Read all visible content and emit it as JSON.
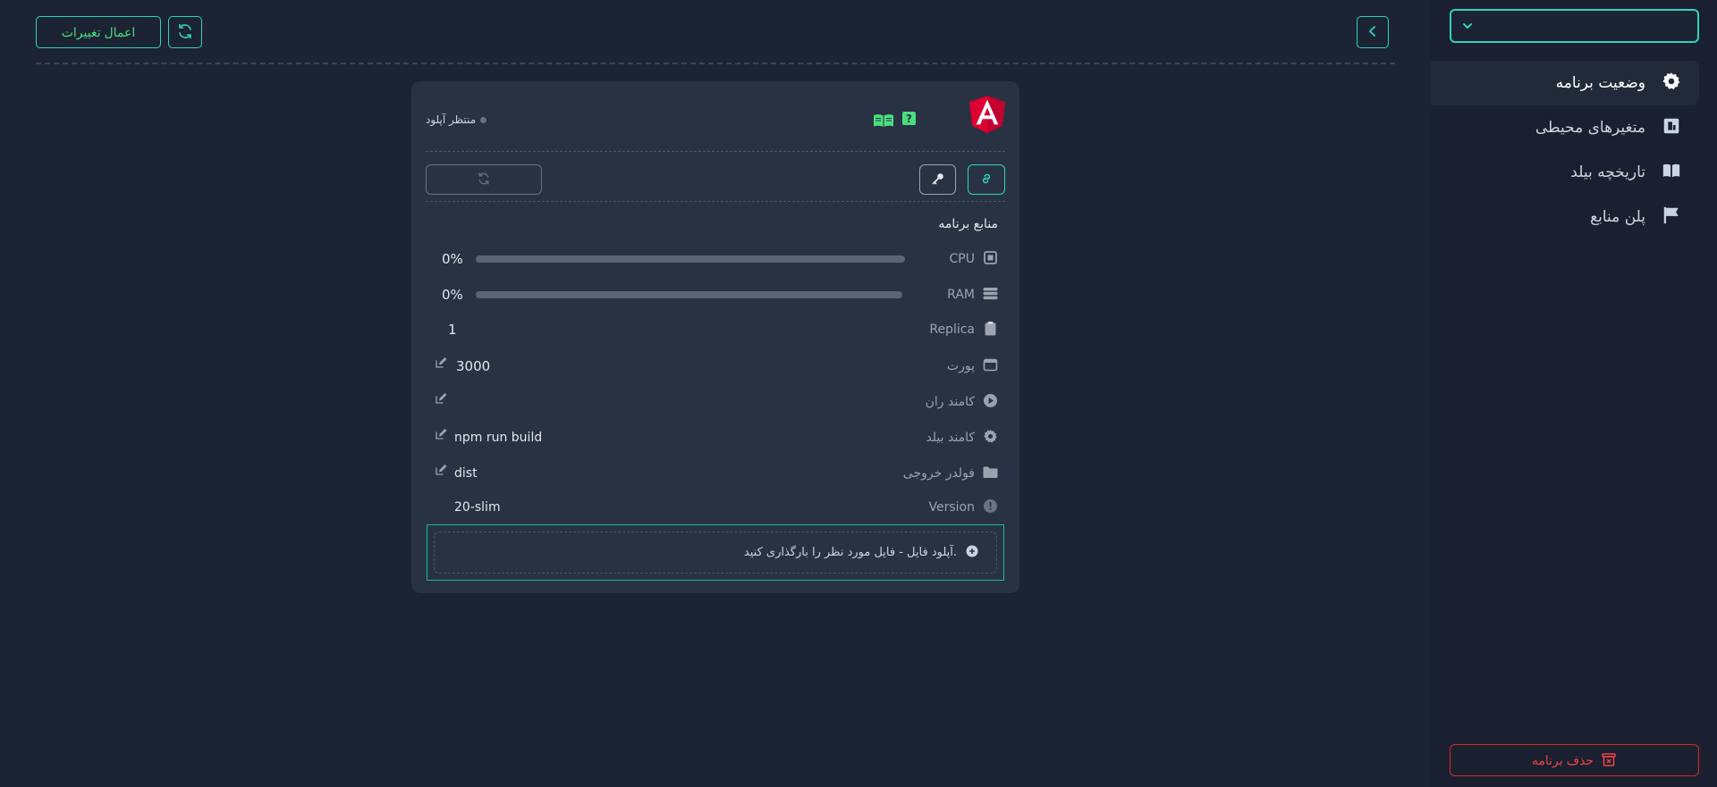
{
  "sidebar": {
    "select": {
      "value": "",
      "icon": "chevron-down-icon"
    },
    "items": [
      {
        "label": "وضعیت برنامه",
        "icon": "gear-icon",
        "active": true
      },
      {
        "label": "متغیرهای محیطی",
        "icon": "env-icon",
        "active": false
      },
      {
        "label": "تاریخچه بیلد",
        "icon": "book-icon",
        "active": false
      },
      {
        "label": "پلن منابع",
        "icon": "flag-icon",
        "active": false
      }
    ],
    "delete_label": "حذف برنامه"
  },
  "topbar": {
    "apply_label": "اعمال تغییرات",
    "refresh_icon": "refresh-icon",
    "back_icon": "chevron-left-icon"
  },
  "card": {
    "status": "منتظر آپلود",
    "logo": "angular-logo",
    "resources_title": "منابع برنامه",
    "rows": {
      "cpu": {
        "label": "CPU",
        "value": "0%",
        "percent": 0
      },
      "ram": {
        "label": "RAM",
        "value": "0%",
        "percent": 0
      },
      "replica": {
        "label": "Replica",
        "value": "1"
      },
      "port": {
        "label": "پورت",
        "value": "3000"
      },
      "run_command": {
        "label": "کامند ران",
        "value": ""
      },
      "build_command": {
        "label": "کامند بیلد",
        "value": "npm run build"
      },
      "output_folder": {
        "label": "فولدر خروجی",
        "value": "dist"
      },
      "version": {
        "label": "Version",
        "value": "20-slim"
      }
    },
    "upload_text": "آپلود فایل - فایل مورد نظر را بارگذاری کنید."
  },
  "colors": {
    "accent": "#2dd4bf",
    "success": "#4ade80",
    "danger": "#ef4444",
    "background": "#1c2333",
    "card": "#283243"
  }
}
